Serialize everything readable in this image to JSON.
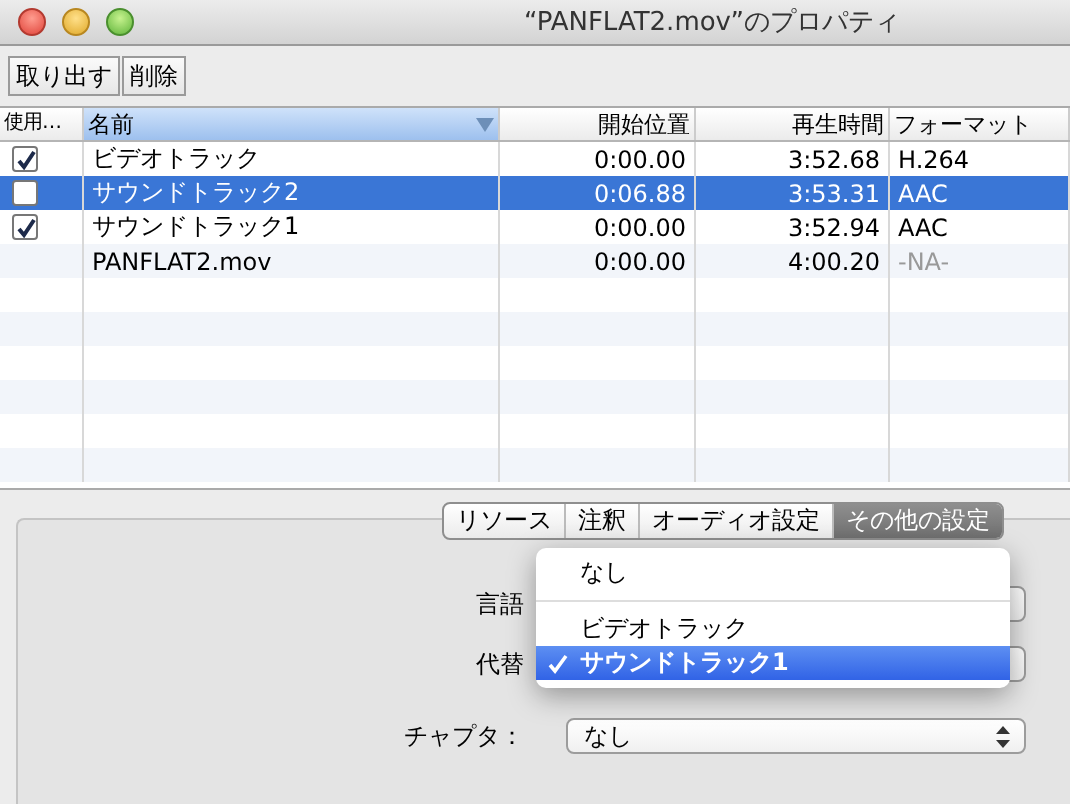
{
  "window": {
    "title": "“PANFLAT2.mov”のプロパティ"
  },
  "toolbar": [
    "取り出す",
    "削除"
  ],
  "table": {
    "columns": [
      {
        "label": "使用…",
        "selected": false
      },
      {
        "label": "名前",
        "selected": true
      },
      {
        "label": "開始位置",
        "selected": false
      },
      {
        "label": "再生時間",
        "selected": false
      },
      {
        "label": "フォーマット",
        "selected": false
      }
    ],
    "rows": [
      {
        "kind": "track",
        "checked": true,
        "selected": false,
        "cells": [
          "",
          "ビデオトラック",
          "0:00.00",
          "3:52.68",
          "H.264"
        ]
      },
      {
        "kind": "track",
        "checked": false,
        "selected": true,
        "cells": [
          "",
          "サウンドトラック2",
          "0:06.88",
          "3:53.31",
          "AAC"
        ]
      },
      {
        "kind": "track",
        "checked": true,
        "selected": false,
        "cells": [
          "",
          "サウンドトラック1",
          "0:00.00",
          "3:52.94",
          "AAC"
        ]
      },
      {
        "kind": "movie",
        "selected": false,
        "cells": [
          "",
          "PANFLAT2.mov",
          "0:00.00",
          "4:00.20",
          "-NA-"
        ]
      }
    ]
  },
  "tabs": [
    {
      "label": "リソース",
      "selected": false
    },
    {
      "label": "注釈",
      "selected": false
    },
    {
      "label": "オーディオ設定",
      "selected": false
    },
    {
      "label": "その他の設定",
      "selected": true
    }
  ],
  "fields": [
    {
      "label": "言語"
    },
    {
      "label": "代替"
    },
    {
      "label": "チャプタ：",
      "value": "なし"
    }
  ],
  "popup": {
    "items": [
      {
        "kind": "item",
        "label": "なし",
        "checked": false,
        "selected": false
      },
      {
        "kind": "separator"
      },
      {
        "kind": "item",
        "label": "ビデオトラック",
        "checked": false,
        "selected": false
      },
      {
        "kind": "item",
        "label": "サウンドトラック1",
        "checked": true,
        "selected": true
      }
    ]
  }
}
